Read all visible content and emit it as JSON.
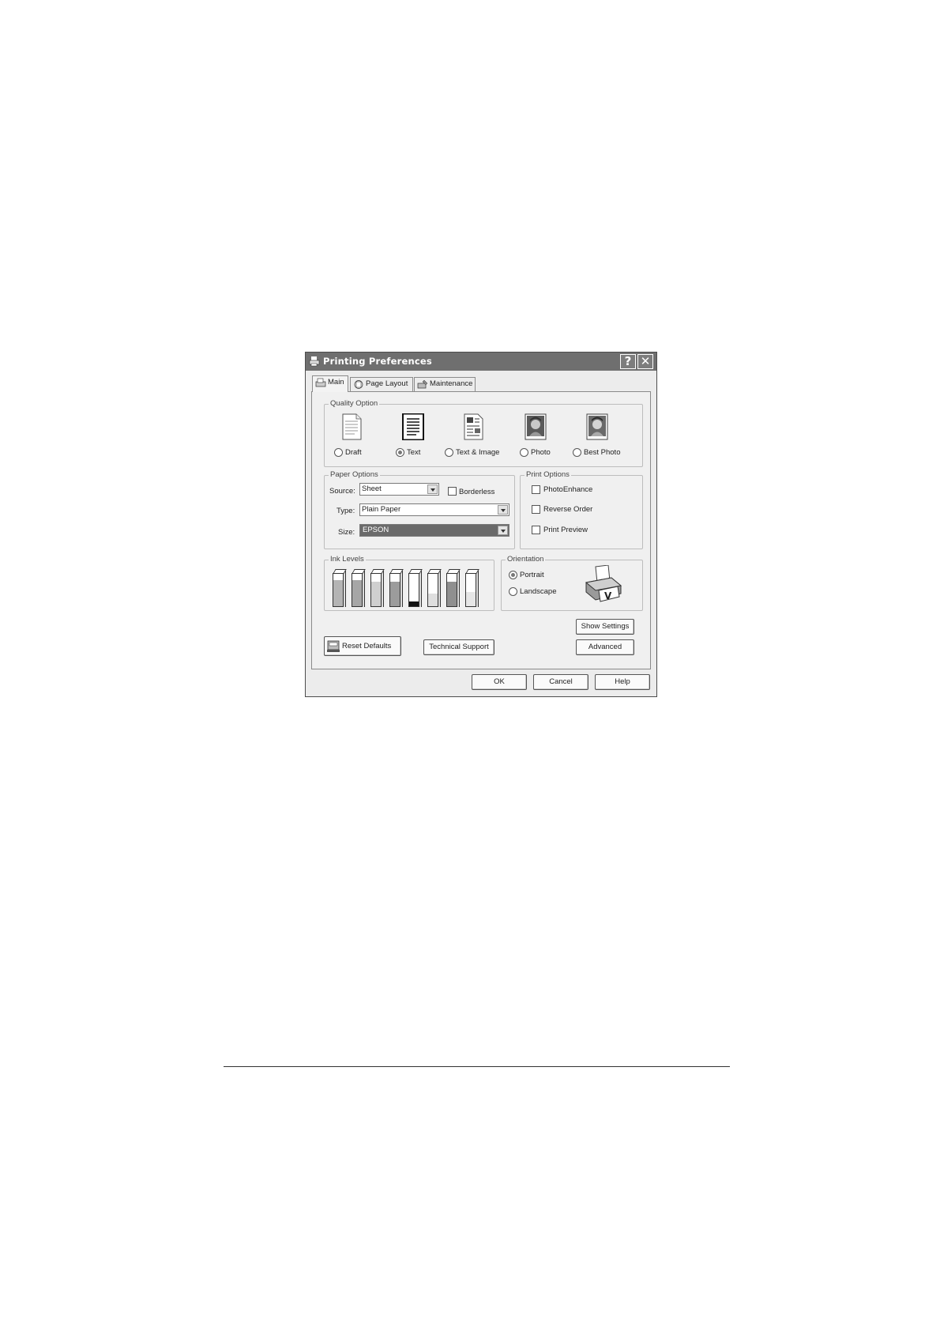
{
  "dialog": {
    "title": "Printing Preferences",
    "help_glyph": "?",
    "close_glyph": "✕"
  },
  "tabs": [
    {
      "label": "Main",
      "icon": "printer-tab-icon",
      "active": true
    },
    {
      "label": "Page Layout",
      "icon": "page-layout-icon",
      "active": false
    },
    {
      "label": "Maintenance",
      "icon": "maintenance-icon",
      "active": false
    }
  ],
  "quality": {
    "group_label": "Quality Option",
    "options": [
      {
        "label": "Draft",
        "icon": "draft-page-icon",
        "selected": false
      },
      {
        "label": "Text",
        "icon": "text-page-icon",
        "selected": true
      },
      {
        "label": "Text & Image",
        "icon": "text-image-page-icon",
        "selected": false
      },
      {
        "label": "Photo",
        "icon": "photo-icon",
        "selected": false
      },
      {
        "label": "Best Photo",
        "icon": "best-photo-icon",
        "selected": false
      }
    ]
  },
  "paper": {
    "group_label": "Paper Options",
    "source_label": "Source:",
    "source_value": "Sheet",
    "borderless_label": "Borderless",
    "type_label": "Type:",
    "type_value": "Plain Paper",
    "size_label": "Size:",
    "size_value": "EPSON"
  },
  "print_options": {
    "group_label": "Print Options",
    "items": [
      {
        "label": "PhotoEnhance",
        "checked": false
      },
      {
        "label": "Reverse Order",
        "checked": false
      },
      {
        "label": "Print Preview",
        "checked": false
      }
    ]
  },
  "ink": {
    "group_label": "Ink Levels",
    "levels": [
      0.8,
      0.8,
      0.75,
      0.75,
      0.15,
      0.4,
      0.75,
      0.45
    ],
    "colors": [
      "#b4b4b4",
      "#a6a6a6",
      "#cfcfcf",
      "#9c9c9c",
      "#111111",
      "#dedede",
      "#8f8f8f",
      "#e6e6e6"
    ]
  },
  "orientation": {
    "group_label": "Orientation",
    "portrait_label": "Portrait",
    "landscape_label": "Landscape",
    "selected": "Portrait",
    "icon": "printer-orientation-icon"
  },
  "buttons": {
    "reset_defaults": "Reset Defaults",
    "technical_support": "Technical Support",
    "show_settings": "Show Settings",
    "advanced": "Advanced",
    "ok": "OK",
    "cancel": "Cancel",
    "help": "Help"
  }
}
